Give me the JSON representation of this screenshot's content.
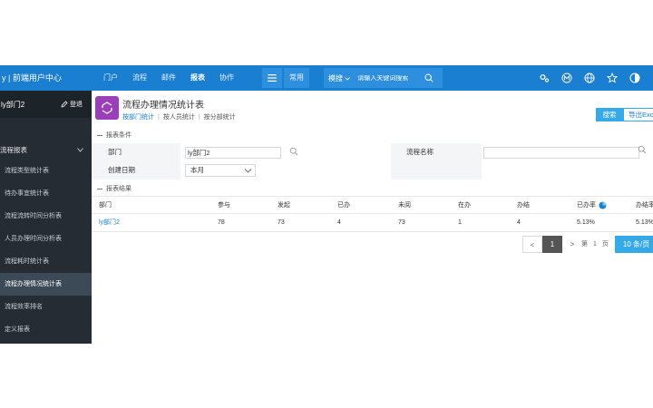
{
  "topbar": {
    "brand": "y | 前端用户中心",
    "nav": [
      "门户",
      "流程",
      "邮件",
      "报表",
      "协作"
    ],
    "active_nav": "报表",
    "common_label": "常用",
    "search_scope": "模搜",
    "search_placeholder": "请输入关键词搜索",
    "icons": [
      "gear-icon",
      "m-icon",
      "globe-icon",
      "star-icon",
      "theme-icon",
      "power-icon"
    ]
  },
  "sidebar": {
    "dept": "ly部门2",
    "logout": "登退",
    "group": "流程报表",
    "items": [
      {
        "label": "流程类型统计表"
      },
      {
        "label": "待办事宜统计表"
      },
      {
        "label": "流程流转时间分析表"
      },
      {
        "label": "人员办理时间分析表"
      },
      {
        "label": "流程耗时统计表"
      },
      {
        "label": "流程办理情况统计表",
        "active": true
      },
      {
        "label": "流程效率排名"
      },
      {
        "label": "定义报表"
      }
    ]
  },
  "main": {
    "title": "流程办理情况统计表",
    "subtabs": [
      "按部门统计",
      "按人员统计",
      "按分部统计"
    ],
    "search_button": "搜索",
    "export_button": "导出Excel",
    "conditions_title": "报表条件",
    "results_title": "报表结果",
    "form": {
      "dept_label": "部门",
      "dept_value": "ly部门2",
      "date_label": "创建日期",
      "date_value": "本月",
      "workflow_label": "流程名称"
    },
    "table": {
      "headers": [
        "部门",
        "参与",
        "发起",
        "已办",
        "未阅",
        "在办",
        "办结",
        "已办率",
        "办结率"
      ],
      "rows": [
        [
          "ly部门2",
          "78",
          "73",
          "4",
          "73",
          "1",
          "4",
          "5.13%",
          "5.13%"
        ]
      ]
    },
    "pager": {
      "prev": "<",
      "current": "1",
      "next": ">",
      "goto_label": "第",
      "goto_value": "1",
      "page_unit": "页",
      "page_size": "10 条/页"
    }
  }
}
